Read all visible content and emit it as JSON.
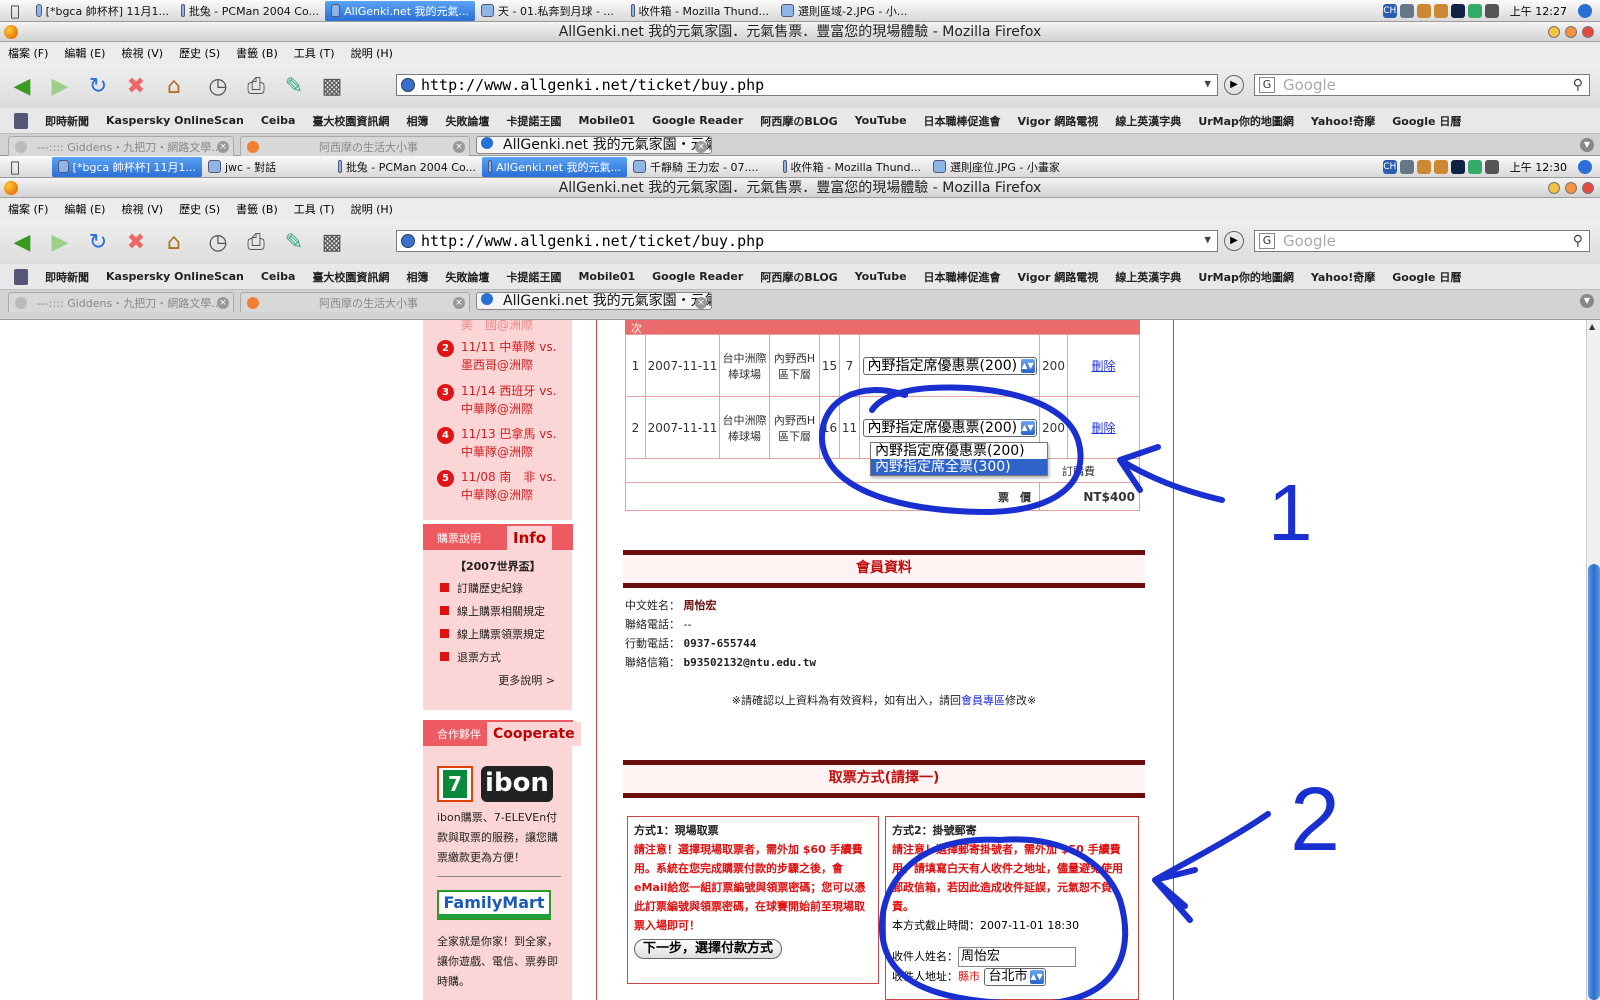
{
  "os_top": {
    "tasks": [
      "[*bgca 帥杯杯] 11月1...",
      "批兔 - PCMan 2004 Co...",
      "AllGenki.net 我的元氣...",
      "天 - 01.私奔到月球 - ...",
      "收件箱 - Mozilla Thund...",
      "選則區域-2.JPG - 小..."
    ],
    "clock": "上午 12:27",
    "input_indicator": "CH"
  },
  "os_bottom": {
    "tasks": [
      "[*bgca 帥杯杯] 11月1...",
      "jwc - 對話",
      "批兔 - PCMan 2004 Co...",
      "AllGenki.net 我的元氣...",
      "千靜騎 王力宏 - 07....",
      "收件箱 - Mozilla Thund...",
      "選則座位.JPG - 小畫家"
    ],
    "clock": "上午 12:30",
    "input_indicator": "CH"
  },
  "window": {
    "title": "AllGenki.net 我的元氣家園．元氣售票．豐富您的現場體驗 - Mozilla Firefox",
    "menu": [
      "檔案 (F)",
      "編輯 (E)",
      "檢視 (V)",
      "歷史 (S)",
      "書籤 (B)",
      "工具 (T)",
      "說明 (H)"
    ],
    "url": "http://www.allgenki.net/ticket/buy.php",
    "search_placeholder": "Google",
    "bookmarks": [
      "即時新聞",
      "Kaspersky OnlineScan",
      "Ceiba",
      "臺大校園資訊網",
      "相簿",
      "失敗論壇",
      "卡提諾王國",
      "Mobile01",
      "Google Reader",
      "阿西摩のBLOG",
      "YouTube",
      "日本職棒促進會",
      "Vigor 網路電視",
      "線上英漢字典",
      "UrMap你的地圖網",
      "Yahoo!奇摩",
      "Google 日曆"
    ],
    "tabs": [
      "---:::: Giddens・九把刀・網路文學...",
      "阿西摩の生活大小事",
      "AllGenki.net 我的元氣家園・元氣售..."
    ]
  },
  "sidebar": {
    "news_top_fragment": "美　國@洲際",
    "news": [
      {
        "num": "2",
        "text": "11/11 中華隊 vs. 墨西哥@洲際"
      },
      {
        "num": "3",
        "text": "11/14 西班牙 vs. 中華隊@洲際"
      },
      {
        "num": "4",
        "text": "11/13 巴拿馬 vs. 中華隊@洲際"
      },
      {
        "num": "5",
        "text": "11/08 南　非 vs. 中華隊@洲際"
      }
    ],
    "info_small": "購票說明",
    "info_big": "Info",
    "info_heading": "【2007世界盃】",
    "info_items": [
      "訂購歷史紀錄",
      "線上購票相關規定",
      "線上購票領票規定",
      "退票方式"
    ],
    "info_more": "更多說明 >",
    "coop_small": "合作夥伴",
    "coop_big": "Cooperate",
    "seven_logo": "7",
    "ibon_logo": "ibon",
    "ibon_text": "ibon購票、7-ELEVEn付款與取票的服務，讓您購票繳款更為方便！",
    "familymart_logo": "FamilyMart",
    "familymart_text": "全家就是你家！到全家，讓你遊戲、電信、票券即時購。"
  },
  "order": {
    "header_fragment": "次",
    "rows": [
      {
        "no": "1",
        "date": "2007-11-11",
        "venue": "台中洲際棒球場",
        "area": "內野西H區下層",
        "row": "15",
        "seat": "7",
        "ticket_type": "內野指定席優惠票(200)",
        "price": "200",
        "action": "刪除"
      },
      {
        "no": "2",
        "date": "2007-11-11",
        "venue": "台中洲際棒球場",
        "area": "內野西H區下層",
        "row": "16",
        "seat": "11",
        "ticket_type": "內野指定席優惠票(200)",
        "price": "200",
        "action": "刪除"
      }
    ],
    "dropdown_options": [
      "內野指定席優惠票(200)",
      "內野指定席全票(300)"
    ],
    "dropdown_highlighted": 1,
    "fee_label": "訂購費",
    "total_label": "票　價",
    "total_value": "NT$400"
  },
  "member": {
    "heading": "會員資料",
    "fields": [
      {
        "label": "中文姓名：",
        "value": "周怡宏"
      },
      {
        "label": "聯絡電話：",
        "value": "--"
      },
      {
        "label": "行動電話：",
        "value": "0937-655744"
      },
      {
        "label": "聯絡信箱：",
        "value": "b93502132@ntu.edu.tw"
      }
    ],
    "note_pre": "※請確認以上資料為有效資料，如有出入，請回",
    "note_link": "會員專區",
    "note_post": "修改※"
  },
  "pickup": {
    "heading": "取票方式(請擇一)",
    "method1_title": "方式1：現場取票",
    "method1_text": "請注意！選擇現場取票者，需外加 $60 手續費用。系統在您完成購票付款的步驟之後，會eMail給您一組訂票編號與領票密碼；您可以憑此訂票編號與領票密碼，在球賽開始前至現場取票入場即可！",
    "method1_button": "下一步，選擇付款方式",
    "method2_title": "方式2：掛號郵寄",
    "method2_text": "請注意！選擇郵寄掛號者，需外加 $50 手續費用。請填寫白天有人收件之地址，儘量避免使用郵政信箱，若因此造成收件延誤，元氣恕不負責。",
    "deadline_label": "本方式截止時間：",
    "deadline_value": "2007-11-01 18:30",
    "recipient_name_label": "收件人姓名：",
    "recipient_name_value": "周怡宏",
    "recipient_addr_label": "收件人地址：",
    "county_label": "縣市",
    "county_value": "台北市"
  },
  "annotations": {
    "mark1": "1",
    "mark2": "2",
    "ink_color": "#1a2fd0"
  }
}
